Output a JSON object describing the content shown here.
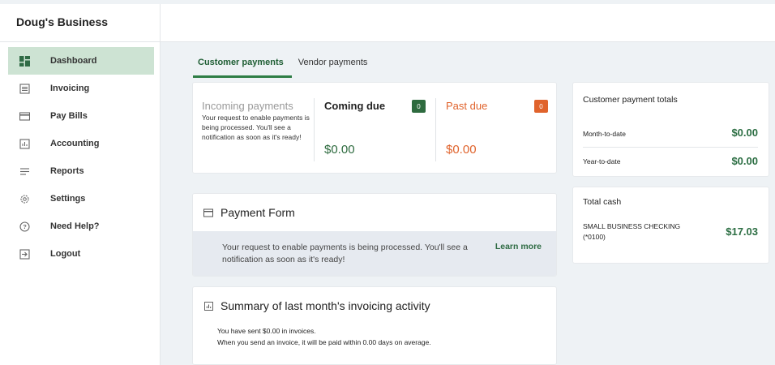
{
  "brand": "Doug's Business",
  "sidebar": {
    "items": [
      {
        "label": "Dashboard",
        "icon": "dashboard-icon",
        "active": true
      },
      {
        "label": "Invoicing",
        "icon": "invoice-icon"
      },
      {
        "label": "Pay Bills",
        "icon": "credit-card-icon"
      },
      {
        "label": "Accounting",
        "icon": "chart-icon"
      },
      {
        "label": "Reports",
        "icon": "reports-icon"
      },
      {
        "label": "Settings",
        "icon": "gear-icon"
      },
      {
        "label": "Need Help?",
        "icon": "help-icon"
      },
      {
        "label": "Logout",
        "icon": "logout-icon"
      }
    ]
  },
  "tabs": [
    {
      "label": "Customer payments",
      "active": true
    },
    {
      "label": "Vendor payments"
    }
  ],
  "incoming": {
    "title": "Incoming payments",
    "description": "Your request to enable payments is being processed. You'll see a notification as soon as it's ready!",
    "coming_due": {
      "title": "Coming due",
      "count": "0",
      "amount": "$0.00",
      "color": "#2e6b3f"
    },
    "past_due": {
      "title": "Past due",
      "count": "0",
      "amount": "$0.00",
      "color": "#e0632c"
    }
  },
  "payment_form": {
    "title": "Payment Form",
    "notice": "Your request to enable payments is being processed. You'll see a notification as soon as it's ready!",
    "link": "Learn more"
  },
  "summary": {
    "title": "Summary of last month's invoicing activity",
    "line1": "You have sent $0.00 in invoices.",
    "line2": "When you send an invoice, it will be paid within 0.00 days on average."
  },
  "totals": {
    "title": "Customer payment totals",
    "month_label": "Month-to-date",
    "month_value": "$0.00",
    "year_label": "Year-to-date",
    "year_value": "$0.00"
  },
  "cash": {
    "title": "Total cash",
    "account_label": "SMALL BUSINESS CHECKING",
    "account_number": "(*0100)",
    "value": "$17.03"
  },
  "colors": {
    "accent_green": "#2e7d45",
    "active_nav": "#cde3d3",
    "past_due_orange": "#e0632c"
  }
}
